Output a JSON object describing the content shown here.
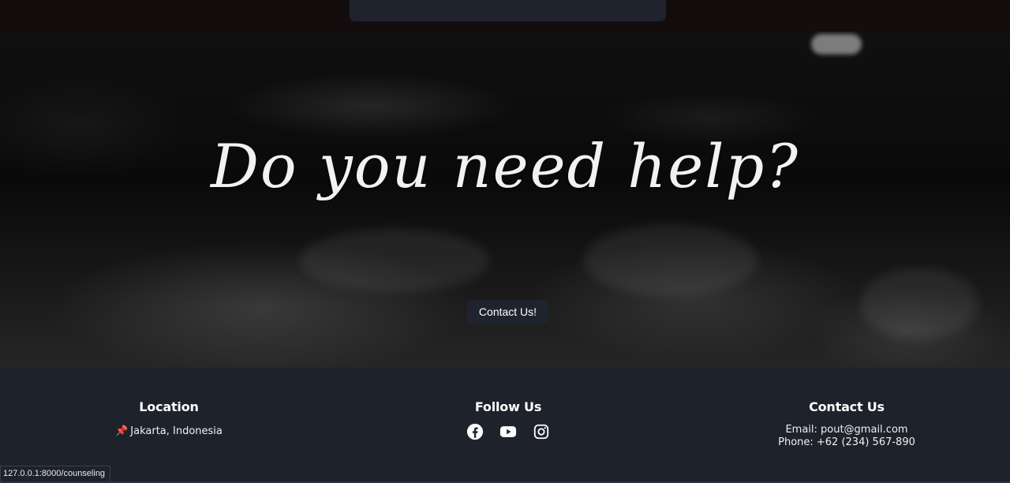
{
  "hero": {
    "title": "Do you need help?",
    "contact_button_label": "Contact Us!"
  },
  "footer": {
    "location": {
      "heading": "Location",
      "pin_icon": "pushpin-icon",
      "address": "Jakarta, Indonesia"
    },
    "follow": {
      "heading": "Follow Us",
      "icons": [
        "facebook-icon",
        "youtube-icon",
        "instagram-icon"
      ]
    },
    "contact": {
      "heading": "Contact Us",
      "email": "Email: pout@gmail.com",
      "phone": "Phone: +62 (234) 567-890"
    }
  },
  "status_bar": {
    "url": "127.0.0.1:8000/counseling"
  },
  "colors": {
    "footer_bg": "#1e222b",
    "button_bg": "#1f232d",
    "pin": "#e23a3a"
  }
}
